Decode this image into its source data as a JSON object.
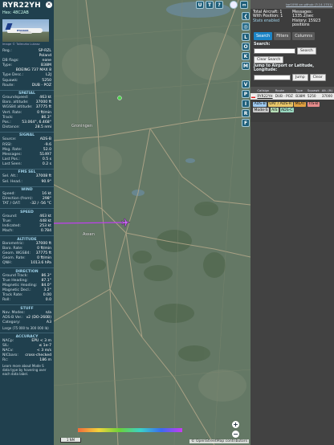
{
  "left_panel": {
    "callsign": "RYR22YH",
    "hex_label": "Hex: 48C2AB",
    "photo_lettering": "RYANAIR",
    "photo_credit": "Image © Tolleczko Lukasz",
    "basic": [
      {
        "k": "Reg.:",
        "v": "SP-RZL"
      },
      {
        "k": "",
        "v": "Poland"
      },
      {
        "k": "DB flags:",
        "v": "none"
      },
      {
        "k": "Type:",
        "v": "B38M"
      },
      {
        "k": "",
        "v": "BOEING 737 MAX 8"
      },
      {
        "k": "Type Desc.:",
        "v": "L2J"
      },
      {
        "k": "Squawk:",
        "v": "5250"
      },
      {
        "k": "Route:",
        "v": "DUB - POZ"
      }
    ],
    "spatial_title": "SPATIAL",
    "spatial": [
      {
        "k": "Groundspeed:",
        "v": "463 kt"
      },
      {
        "k": "Baro. altitude:",
        "v": "37000 ft"
      },
      {
        "k": "WGS84 altitude:",
        "v": "37775 ft"
      },
      {
        "k": "Vert. Rate:",
        "v": "0 ft/min"
      },
      {
        "k": "Track:",
        "v": "86.3°"
      },
      {
        "k": "Pos.:",
        "v": "53.064°, 6.468°"
      },
      {
        "k": "Distance:",
        "v": "28.5 nmi"
      }
    ],
    "signal_title": "SIGNAL",
    "signal": [
      {
        "k": "Source:",
        "v": "ADS-B"
      },
      {
        "k": "RSSI:",
        "v": "-9.6"
      },
      {
        "k": "Msg. Rate:",
        "v": "52.0"
      },
      {
        "k": "Messages:",
        "v": "51497"
      },
      {
        "k": "Last Pos.:",
        "v": "0.5 s"
      },
      {
        "k": "Last Seen:",
        "v": "0.2 s"
      }
    ],
    "fms_title": "FMS SEL",
    "fms": [
      {
        "k": "Sel. Alt.:",
        "v": "37008 ft"
      },
      {
        "k": "Sel. Head.:",
        "v": "90.9°"
      }
    ],
    "wind_title": "WIND",
    "wind": [
      {
        "k": "Speed:",
        "v": "16 kt"
      },
      {
        "k": "Direction (from):",
        "v": "298°"
      },
      {
        "k": "TAT / OAT:",
        "v": "-32 / -56 °C"
      }
    ],
    "speed_title": "SPEED",
    "speed": [
      {
        "k": "Ground:",
        "v": "463 kt"
      },
      {
        "k": "True:",
        "v": "448 kt"
      },
      {
        "k": "Indicated:",
        "v": "253 kt"
      },
      {
        "k": "Mach:",
        "v": "0.784"
      }
    ],
    "altitude_title": "ALTITUDE",
    "altitude": [
      {
        "k": "Barometric:",
        "v": "37000 ft"
      },
      {
        "k": "Baro. Rate:",
        "v": "0 ft/min"
      },
      {
        "k": "Geom. WGS84:",
        "v": "37775 ft"
      },
      {
        "k": "Geom. Rate:",
        "v": "0 ft/min"
      },
      {
        "k": "QNH:",
        "v": "1013.6 hPa"
      }
    ],
    "direction_title": "DIRECTION",
    "direction": [
      {
        "k": "Ground Track:",
        "v": "86.3°"
      },
      {
        "k": "True Heading:",
        "v": "87.1°"
      },
      {
        "k": "Magnetic Heading:",
        "v": "84.0°"
      },
      {
        "k": "Magnetic Decl.:",
        "v": "3.2°"
      },
      {
        "k": "Track Rate:",
        "v": "0.00"
      },
      {
        "k": "Roll:",
        "v": "0.0"
      }
    ],
    "stuff_title": "STUFF",
    "stuff": [
      {
        "k": "Nav. Modes:",
        "v": "n/a"
      },
      {
        "k": "ADS-B Ver.:",
        "v": "v2 (DO-260B)"
      },
      {
        "k": "Category:",
        "v": "A3"
      }
    ],
    "category_desc": "Large (75 000 to 300 000 lb)",
    "accuracy_title": "ACCURACY",
    "accuracy": [
      {
        "k": "NACp:",
        "v": "EPU < 3 m"
      },
      {
        "k": "SIL:",
        "v": "≤ 1e-7"
      },
      {
        "k": "NACv:",
        "v": "< 3 m/s"
      },
      {
        "k": "NICbaro:",
        "v": "cross-checked"
      },
      {
        "k": "Rc:",
        "v": "186 m"
      }
    ],
    "footer_note": "Learn more about Mode S data type by hovering over each data label."
  },
  "map": {
    "labels": [
      {
        "text": "Groningen",
        "key": "groningen"
      },
      {
        "text": "Assen",
        "key": "assen"
      }
    ],
    "controls_top": [
      "U",
      "T",
      "?"
    ],
    "controls_side": [
      "L",
      "O",
      "K",
      "M",
      "V",
      "P",
      "I",
      "R",
      "F"
    ],
    "zoom_in": "+",
    "zoom_out": "−",
    "scale": "1 NM",
    "attribution": "© OpenStreetMap contributors"
  },
  "right_panel": {
    "top_link": "tar1090 on github (3.14.1701)",
    "total_aircraft_label": "Total Aircraft: 1",
    "with_position_label": "With Position: 1",
    "messages_label": "Messages:",
    "messages_value": "1335.2/sec",
    "history_label": "History: 15923 positions",
    "stats_label": "Stats enabled",
    "tabs": [
      "Search",
      "Filters",
      "Columns"
    ],
    "search_label": "Search:",
    "search_button": "Search",
    "clear_search": "Clear Search",
    "jump_label": "Jump to Airport or Latitude, Longitude:",
    "jump_button": "Jump",
    "clear_button": "Clear",
    "table_headers": [
      "Callsign",
      "Route",
      "Type",
      "Squawk",
      "Alt. (ft)"
    ],
    "table_row": {
      "callsign": "RYR22YH",
      "route": "DUB - POZ",
      "type": "B38M",
      "squawk": "5250",
      "alt": "37000"
    },
    "filter_chips": [
      {
        "label": "ADS-B",
        "color": "#9ec9f0"
      },
      {
        "label": "UAT / ADS-R",
        "color": "#e8c66a"
      },
      {
        "label": "MLAT",
        "color": "#e0a040"
      },
      {
        "label": "TIS-B",
        "color": "#e48a8a"
      },
      {
        "label": "Mode-S",
        "color": "#c8c8c8"
      },
      {
        "label": "AIS",
        "color": "#b8e0b8"
      },
      {
        "label": "ADS-C",
        "color": "#9ad8c0"
      }
    ]
  }
}
